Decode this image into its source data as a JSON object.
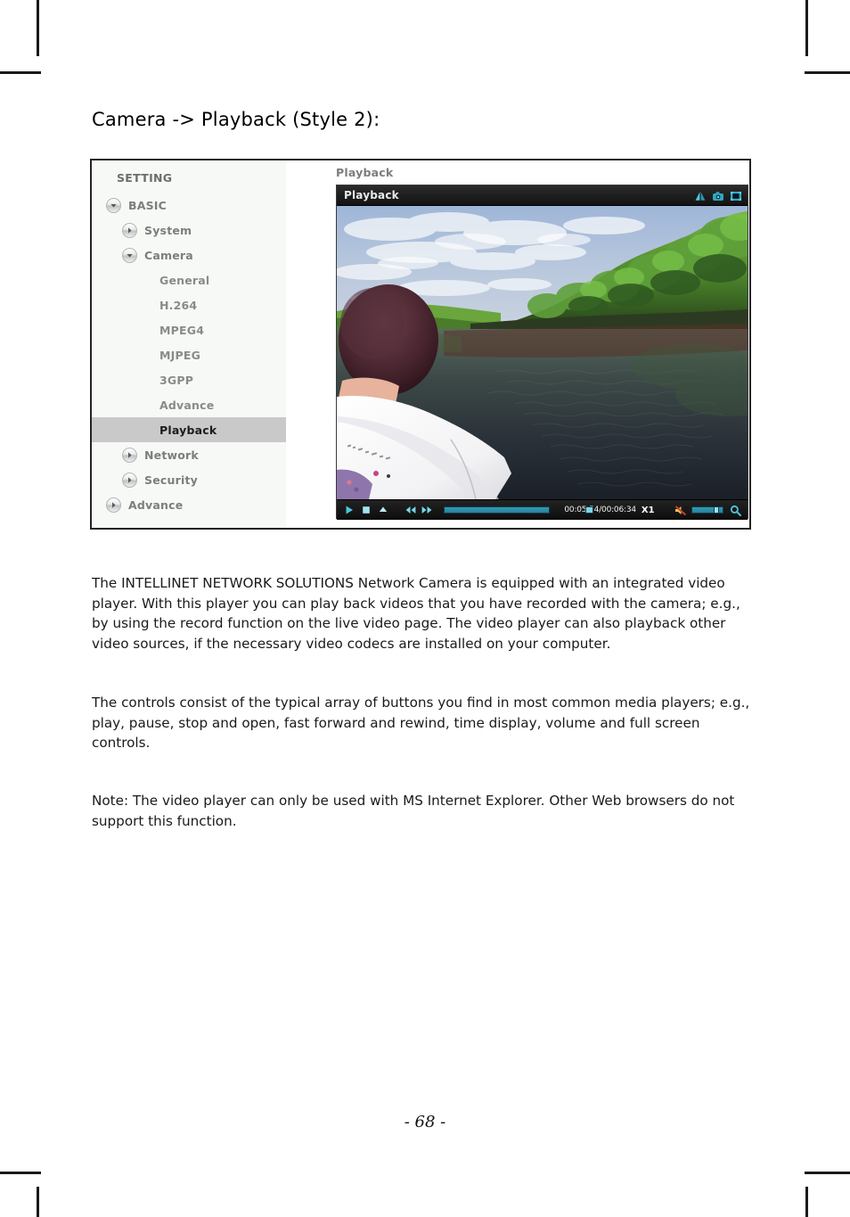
{
  "page": {
    "heading": "Camera -> Playback (Style 2):",
    "page_number": "- 68 -"
  },
  "screenshot": {
    "settings_panel": {
      "title": "SETTING",
      "items": [
        {
          "label": "BASIC",
          "indent": 0,
          "icon": "chevron-down-disc",
          "selected": false
        },
        {
          "label": "System",
          "indent": 1,
          "icon": "chevron-right-disc",
          "selected": false
        },
        {
          "label": "Camera",
          "indent": 1,
          "icon": "chevron-down-disc",
          "selected": false
        },
        {
          "label": "General",
          "indent": 2,
          "icon": "none",
          "selected": false
        },
        {
          "label": "H.264",
          "indent": 2,
          "icon": "none",
          "selected": false
        },
        {
          "label": "MPEG4",
          "indent": 2,
          "icon": "none",
          "selected": false
        },
        {
          "label": "MJPEG",
          "indent": 2,
          "icon": "none",
          "selected": false
        },
        {
          "label": "3GPP",
          "indent": 2,
          "icon": "none",
          "selected": false
        },
        {
          "label": "Advance",
          "indent": 2,
          "icon": "none",
          "selected": false
        },
        {
          "label": "Playback",
          "indent": 2,
          "icon": "none",
          "selected": true
        },
        {
          "label": "Network",
          "indent": 1,
          "icon": "chevron-right-disc",
          "selected": false
        },
        {
          "label": "Security",
          "indent": 1,
          "icon": "chevron-right-disc",
          "selected": false
        },
        {
          "label": "Advance",
          "indent": 0,
          "icon": "chevron-right-disc",
          "selected": false
        }
      ],
      "selected_highlight_color": "#c9c9c9"
    },
    "playback_pane": {
      "title": "Playback",
      "player": {
        "titlebar_label": "Playback",
        "titlebar_icons": [
          "flip-mirror-icon",
          "snapshot-camera-icon",
          "fullscreen-icon"
        ],
        "controls": {
          "buttons": [
            "play-button",
            "stop-button",
            "eject-button",
            "rewind-button",
            "fast-forward-button"
          ],
          "seek_percent": 90,
          "current_time": "00:05:54",
          "total_time": "00:06:34",
          "time_display": "00:05:54/00:06:34",
          "speed": "X1",
          "mute_icon": "volume-muted-icon",
          "volume_percent": 88,
          "zoom_icon": "magnifier-icon",
          "accent_color": "#2f9cb8"
        },
        "video_scene": "River with mangrove trees, cloudy blue sky, white boat bow and a passenger in the foreground"
      }
    }
  },
  "content": {
    "paragraph_1": "The INTELLINET NETWORK SOLUTIONS Network Camera is equipped with an integrated video player. With this player you can play back videos that you have recorded with the camera; e.g., by using the record function on the live video page. The video player can also playback other video sources, if the necessary video codecs are installed on your computer.",
    "paragraph_2": "The controls consist of the typical array of buttons you find in most common media players; e.g., play, pause, stop and open, fast forward and rewind, time display, volume and full screen controls.",
    "paragraph_3": "Note: The video player can only be used with MS Internet Explorer. Other Web browsers do not support this function."
  }
}
